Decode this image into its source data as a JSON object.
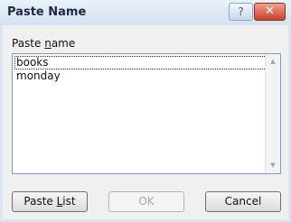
{
  "window": {
    "title": "Paste Name",
    "help_glyph": "?",
    "close_glyph": "✕"
  },
  "field_label": {
    "prefix": "Paste ",
    "accel": "n",
    "suffix": "ame"
  },
  "names": [
    "books",
    "monday"
  ],
  "selected_name": "books",
  "scrollbar": {
    "up_glyph": "▲",
    "down_glyph": "▼"
  },
  "buttons": {
    "paste_list": {
      "prefix": "Paste ",
      "accel": "L",
      "suffix": "ist",
      "enabled": true
    },
    "ok": {
      "label": "OK",
      "enabled": false
    },
    "cancel": {
      "label": "Cancel",
      "enabled": true
    }
  }
}
